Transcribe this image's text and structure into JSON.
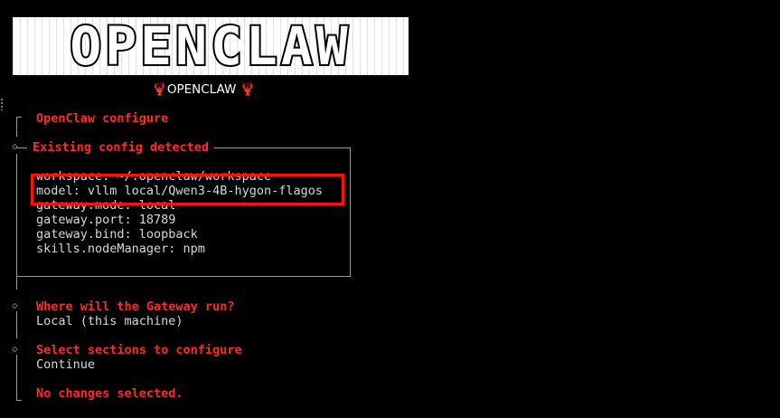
{
  "banner": {
    "text": "OPENCLAW"
  },
  "subtitle": {
    "emoji_left": "🦞",
    "label": "OPENCLAW",
    "emoji_right": "🦞"
  },
  "steps": {
    "configure_title": "OpenClaw configure",
    "existing_config_title": "Existing config detected",
    "config_lines": {
      "workspace": "workspace: ~/.openclaw/workspace",
      "model": "model: vllm local/Qwen3-4B-hygon-flagos",
      "gateway_mode": "gateway.mode: local",
      "gateway_port": "gateway.port: 18789",
      "gateway_bind": "gateway.bind: loopback",
      "node_manager": "skills.nodeManager: npm"
    },
    "gateway_question": "Where will the Gateway run?",
    "gateway_answer": "Local (this machine)",
    "sections_question": "Select sections to configure",
    "sections_answer": "Continue",
    "result": "No changes selected."
  },
  "colors": {
    "background": "#000000",
    "accent_red": "#ff2a2a",
    "highlight_red": "#ff1010",
    "step_diamond_green": "#3cc23c",
    "text_gray": "#d8d8d8"
  },
  "icons": {
    "step_marker": "diamond-icon",
    "subtitle_emoji": "lobster-icon"
  }
}
